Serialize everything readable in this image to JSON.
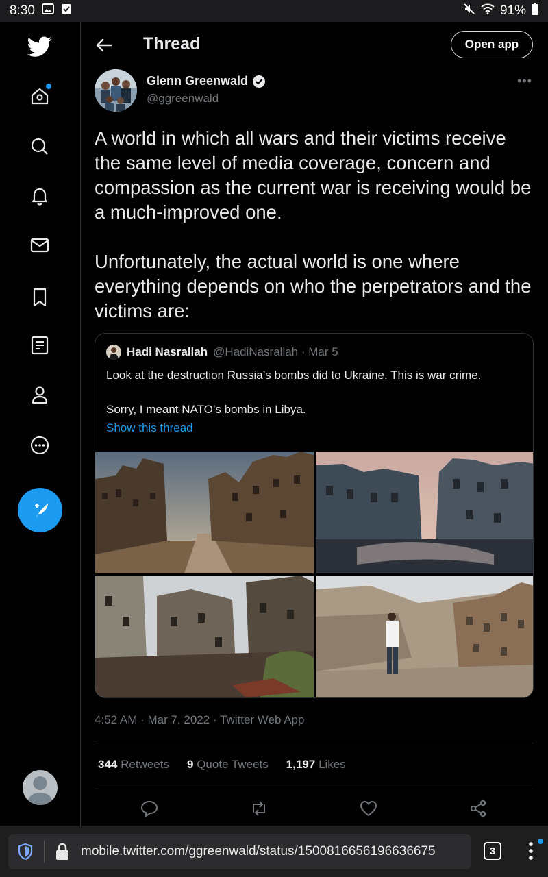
{
  "status_bar": {
    "time": "8:30",
    "battery": "91%"
  },
  "sidebar": {
    "items": [
      {
        "icon": "twitter-bird-icon"
      },
      {
        "icon": "home-icon"
      },
      {
        "icon": "search-icon"
      },
      {
        "icon": "bell-icon"
      },
      {
        "icon": "mail-icon"
      },
      {
        "icon": "bookmark-icon"
      },
      {
        "icon": "lists-icon"
      },
      {
        "icon": "profile-icon"
      },
      {
        "icon": "more-circle-icon"
      }
    ],
    "accent": "#1d9bf0"
  },
  "header": {
    "title": "Thread",
    "open_app": "Open app"
  },
  "tweet": {
    "author_name": "Glenn Greenwald",
    "author_handle": "@ggreenwald",
    "verified": true,
    "text": "A world in which all wars and their victims receive the same level of media coverage, concern and compassion as the current war is receiving would be a much-improved one.\n\nUnfortunately, the actual world is one where everything depends on who the perpetrators and the victims are:",
    "timestamp": "4:52 AM · Mar 7, 2022 · Twitter Web App",
    "stats": {
      "retweets_count": "344",
      "retweets_label": "Retweets",
      "quotes_count": "9",
      "quotes_label": "Quote Tweets",
      "likes_count": "1,197",
      "likes_label": "Likes"
    }
  },
  "quoted": {
    "name": "Hadi Nasrallah",
    "meta": "@HadiNasrallah · Mar 5",
    "text": "Look at the destruction Russia’s bombs did to Ukraine. This is war crime.\n\nSorry, I meant NATO’s bombs in Libya.",
    "show_thread": "Show this thread"
  },
  "browser": {
    "url": "mobile.twitter.com/ggreenwald/status/1500816656196636675",
    "tab_count": "3"
  }
}
